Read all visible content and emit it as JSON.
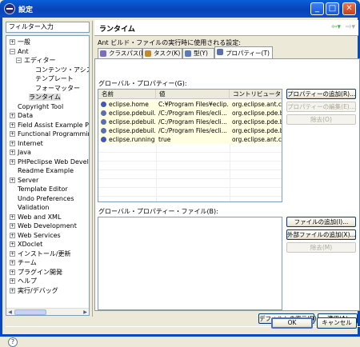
{
  "window": {
    "title": "設定",
    "minimize": "_",
    "maximize": "□",
    "close": "✕"
  },
  "filter": {
    "placeholder": "フィルター入力"
  },
  "tree": [
    {
      "label": "一般",
      "expander": "+",
      "depth": 0
    },
    {
      "label": "Ant",
      "expander": "−",
      "depth": 0
    },
    {
      "label": "エディター",
      "expander": "−",
      "depth": 1
    },
    {
      "label": "コンテンツ・アシスト",
      "expander": "",
      "depth": 3
    },
    {
      "label": "テンプレート",
      "expander": "",
      "depth": 3
    },
    {
      "label": "フォーマッター",
      "expander": "",
      "depth": 3
    },
    {
      "label": "ランタイム",
      "expander": "",
      "depth": 2,
      "selected": true
    },
    {
      "label": "Copyright Tool",
      "expander": "",
      "depth": 0
    },
    {
      "label": "Data",
      "expander": "+",
      "depth": 0
    },
    {
      "label": "Field Assist Example P",
      "expander": "+",
      "depth": 0
    },
    {
      "label": "Functional Programmin",
      "expander": "+",
      "depth": 0
    },
    {
      "label": "Internet",
      "expander": "+",
      "depth": 0
    },
    {
      "label": "Java",
      "expander": "+",
      "depth": 0
    },
    {
      "label": "PHPeclipse Web Develo",
      "expander": "+",
      "depth": 0
    },
    {
      "label": "Readme Example",
      "expander": "",
      "depth": 0
    },
    {
      "label": "Server",
      "expander": "+",
      "depth": 0
    },
    {
      "label": "Template Editor",
      "expander": "",
      "depth": 0
    },
    {
      "label": "Undo Preferences",
      "expander": "",
      "depth": 0
    },
    {
      "label": "Validation",
      "expander": "",
      "depth": 0
    },
    {
      "label": "Web and XML",
      "expander": "+",
      "depth": 0
    },
    {
      "label": "Web Development",
      "expander": "+",
      "depth": 0
    },
    {
      "label": "Web Services",
      "expander": "+",
      "depth": 0
    },
    {
      "label": "XDoclet",
      "expander": "+",
      "depth": 0
    },
    {
      "label": "インストール/更新",
      "expander": "+",
      "depth": 0
    },
    {
      "label": "チーム",
      "expander": "+",
      "depth": 0
    },
    {
      "label": "プラグイン開発",
      "expander": "+",
      "depth": 0
    },
    {
      "label": "ヘルプ",
      "expander": "+",
      "depth": 0
    },
    {
      "label": "実行/デバッグ",
      "expander": "+",
      "depth": 0
    }
  ],
  "page": {
    "title": "ランタイム",
    "nav_back": "⇦▾",
    "nav_forward": "⇨▾",
    "description": "Ant ビルド・ファイルの実行時に使用される設定:"
  },
  "tabs": [
    {
      "label": "クラスパス(L)",
      "icon_color": "#7a6fbf"
    },
    {
      "label": "タスク(K)",
      "icon_color": "#c08a2a"
    },
    {
      "label": "型(Y)",
      "icon_color": "#5a7ab8"
    },
    {
      "label": "プロパティー(T)",
      "icon_color": "#5a6fb0",
      "active": true
    }
  ],
  "global_props": {
    "label": "グローバル・プロパティー(G):",
    "columns": [
      "名前",
      "値",
      "コントリビューター"
    ],
    "rows": [
      {
        "name": "eclipse.home",
        "value": "C:¥Program Files¥eclip...",
        "contributor": "org.eclipse.ant.co...",
        "icon": "#4257b8"
      },
      {
        "name": "eclipse.pdebuil...",
        "value": "/C:/Program Files/ecli...",
        "contributor": "org.eclipse.pde.b...",
        "icon": "#5a6fb0"
      },
      {
        "name": "eclipse.pdebuil...",
        "value": "/C:/Program Files/ecli...",
        "contributor": "org.eclipse.pde.b...",
        "icon": "#5a6fb0"
      },
      {
        "name": "eclipse.pdebuil...",
        "value": "/C:/Program Files/ecli...",
        "contributor": "org.eclipse.pde.b...",
        "icon": "#5a6fb0"
      },
      {
        "name": "eclipse.running",
        "value": "true",
        "contributor": "org.eclipse.ant.co...",
        "icon": "#4257b8"
      }
    ]
  },
  "buttons": {
    "add_property": "プロパティーの追加(R)...",
    "edit_property": "プロパティーの編集(E)...",
    "remove_property": "除去(O)",
    "add_file": "ファイルの追加(I)...",
    "add_external_file": "外部ファイルの追加(X)...",
    "remove_file": "除去(M)",
    "restore_defaults": "デフォルトの復元(D)",
    "apply": "適用(A)",
    "ok": "OK",
    "cancel": "キャンセル"
  },
  "global_files": {
    "label": "グローバル・プロパティー・ファイル(B):"
  },
  "help": "?"
}
